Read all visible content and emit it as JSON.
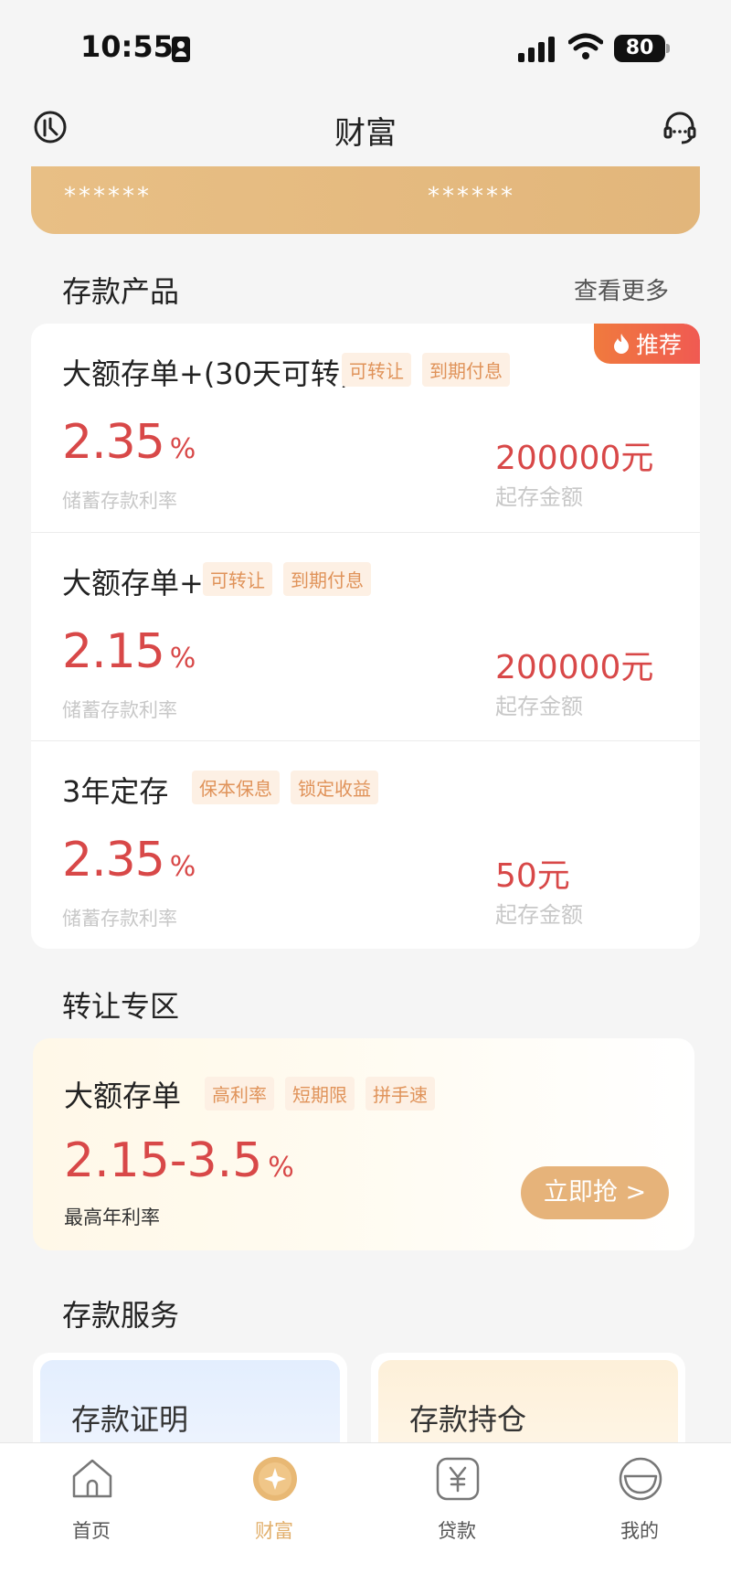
{
  "status_bar": {
    "time": "10:55",
    "battery": "80"
  },
  "header": {
    "title": "财富"
  },
  "asset_card": {
    "left_value": "******",
    "right_value": "******"
  },
  "deposit_products": {
    "title": "存款产品",
    "more": "查看更多",
    "badge": "推荐",
    "items": [
      {
        "name": "大额存单+(30天可转)",
        "tags": [
          "可转让",
          "到期付息"
        ],
        "rate": "2.35",
        "rate_unit": "%",
        "rate_label": "储蓄存款利率",
        "amount": "200000元",
        "amount_label": "起存金额"
      },
      {
        "name": "大额存单+",
        "tags": [
          "可转让",
          "到期付息"
        ],
        "rate": "2.15",
        "rate_unit": "%",
        "rate_label": "储蓄存款利率",
        "amount": "200000元",
        "amount_label": "起存金额"
      },
      {
        "name": "3年定存",
        "tags": [
          "保本保息",
          "锁定收益"
        ],
        "rate": "2.35",
        "rate_unit": "%",
        "rate_label": "储蓄存款利率",
        "amount": "50元",
        "amount_label": "起存金额"
      }
    ]
  },
  "transfer_zone": {
    "title": "转让专区",
    "product_name": "大额存单",
    "tags": [
      "高利率",
      "短期限",
      "拼手速"
    ],
    "rate": "2.15-3.5",
    "rate_unit": "%",
    "rate_label": "最高年利率",
    "button": "立即抢 >"
  },
  "deposit_services": {
    "title": "存款服务",
    "items": [
      "存款证明",
      "存款持仓"
    ]
  },
  "bottom_nav": {
    "items": [
      {
        "label": "首页",
        "icon": "home-icon"
      },
      {
        "label": "财富",
        "icon": "wealth-icon"
      },
      {
        "label": "贷款",
        "icon": "loan-icon"
      },
      {
        "label": "我的",
        "icon": "profile-icon"
      }
    ]
  },
  "colors": {
    "accent_gold": "#e2b06d",
    "rate_red": "#d84848",
    "tag_text": "#e0935a",
    "tag_bg": "#fdf0e4",
    "badge_red": "#f05a52"
  }
}
